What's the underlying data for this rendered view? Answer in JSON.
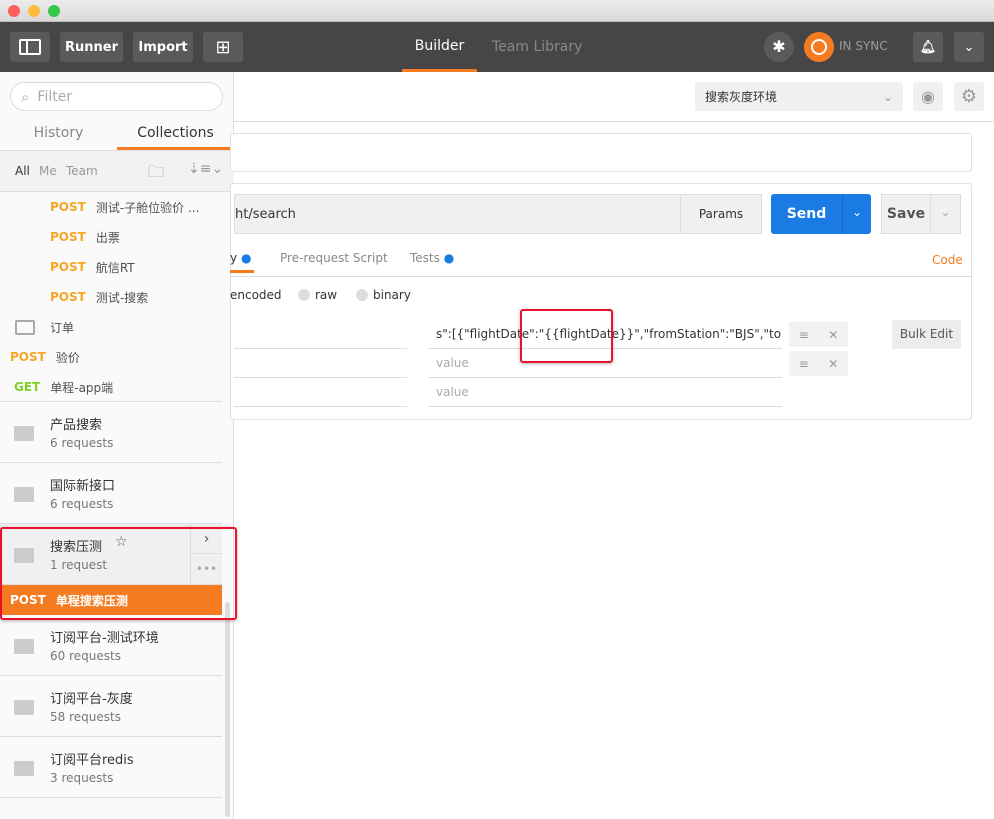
{
  "header": {
    "runner": "Runner",
    "import": "Import",
    "tabs": [
      {
        "label": "Builder",
        "active": true
      },
      {
        "label": "Team Library"
      }
    ],
    "sync": "IN SYNC"
  },
  "sidebar": {
    "filter_placeholder": "Filter",
    "tabs": [
      "History",
      "Collections"
    ],
    "active_tab": "Collections",
    "filters": [
      "All",
      "Me",
      "Team"
    ],
    "items": [
      {
        "method": "POST",
        "name": "测试-子舱位验价 ..."
      },
      {
        "method": "POST",
        "name": "出票"
      },
      {
        "method": "POST",
        "name": "航信RT"
      },
      {
        "method": "POST",
        "name": "测试-搜索"
      },
      {
        "folder": true,
        "name": "订单"
      },
      {
        "method": "POST",
        "name": "验价"
      },
      {
        "method": "GET",
        "name": "单程-app端"
      }
    ],
    "collections_top": [
      {
        "name": "产品搜索",
        "count": "6 requests"
      },
      {
        "name": "国际新接口",
        "count": "6 requests"
      },
      {
        "name": "搜索压测",
        "count": "1 request"
      }
    ],
    "selected_request": {
      "method": "POST",
      "name": "单程搜索压测"
    },
    "collections_bottom": [
      {
        "name": "订阅平台-测试环境",
        "count": "60 requests"
      },
      {
        "name": "订阅平台-灰度",
        "count": "58 requests"
      },
      {
        "name": "订阅平台redis",
        "count": "3 requests"
      }
    ]
  },
  "env": {
    "selected": "搜索灰度环境"
  },
  "request": {
    "url": "ht/search",
    "params": "Params",
    "send": "Send",
    "save": "Save",
    "tabs": [
      "y",
      "Pre-request Script",
      "Tests"
    ],
    "code": "Code",
    "body_types": [
      "encoded",
      "raw",
      "binary"
    ],
    "rows": [
      {
        "value": "s\":[{\"flightDate\":\"{{flightDate}}\",\"fromStation\":\"BJS\",\"toStatior"
      },
      {
        "value_placeholder": "value"
      },
      {
        "value_placeholder": "value"
      }
    ],
    "bulk_edit": "Bulk Edit"
  },
  "colors": {
    "accent": "#f47b20",
    "send": "#1a7be5",
    "post": "#f5a623",
    "get": "#7ed321",
    "highlight": "#e8132a"
  }
}
